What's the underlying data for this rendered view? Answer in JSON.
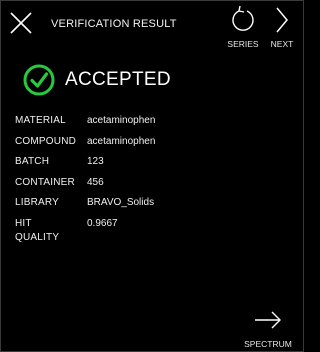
{
  "header": {
    "title": "VERIFICATION RESULT",
    "close_icon": "close-icon",
    "series": {
      "label": "SERIES",
      "icon": "refresh-icon"
    },
    "next": {
      "label": "NEXT",
      "icon": "chevron-right-icon"
    }
  },
  "result": {
    "status": "ACCEPTED",
    "status_icon": "check-circle-icon",
    "status_color": "#27c93f"
  },
  "details": [
    {
      "key": "MATERIAL",
      "value": "acetaminophen"
    },
    {
      "key": "COMPOUND",
      "value": "acetaminophen"
    },
    {
      "key": "BATCH",
      "value": "123"
    },
    {
      "key": "CONTAINER",
      "value": "456"
    },
    {
      "key": "LIBRARY",
      "value": "BRAVO_Solids"
    },
    {
      "key": "HIT QUALITY",
      "value": "0.9667"
    }
  ],
  "footer": {
    "spectrum": {
      "label": "SPECTRUM",
      "icon": "arrow-right-icon"
    }
  }
}
